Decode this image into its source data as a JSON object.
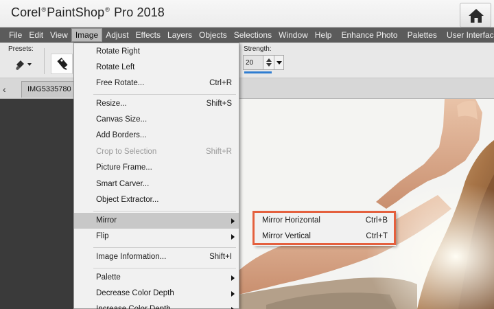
{
  "app": {
    "title_part1": "Corel",
    "title_reg": "®",
    "title_part2": "PaintShop",
    "title_reg2": "®",
    "title_part3": "Pro 2018"
  },
  "menubar": {
    "items": [
      "File",
      "Edit",
      "View",
      "Image",
      "Adjust",
      "Effects",
      "Layers",
      "Objects",
      "Selections",
      "Window",
      "Help",
      "Enhance Photo",
      "Palettes",
      "User Interface"
    ],
    "active": "Image"
  },
  "toolbar": {
    "presets_label": "Presets:",
    "strength_label": "Strength:",
    "strength_value": "20"
  },
  "tabs": {
    "document": "IMG5335780"
  },
  "image_menu": {
    "items": [
      {
        "label": "Rotate Right",
        "shortcut": ""
      },
      {
        "label": "Rotate Left",
        "shortcut": ""
      },
      {
        "label": "Free Rotate...",
        "shortcut": "Ctrl+R"
      },
      {
        "label": "Resize...",
        "shortcut": "Shift+S"
      },
      {
        "label": "Canvas Size...",
        "shortcut": ""
      },
      {
        "label": "Add Borders...",
        "shortcut": ""
      },
      {
        "label": "Crop to Selection",
        "shortcut": "Shift+R"
      },
      {
        "label": "Picture Frame...",
        "shortcut": ""
      },
      {
        "label": "Smart Carver...",
        "shortcut": ""
      },
      {
        "label": "Object Extractor...",
        "shortcut": ""
      },
      {
        "label": "Mirror",
        "shortcut": ""
      },
      {
        "label": "Flip",
        "shortcut": ""
      },
      {
        "label": "Image Information...",
        "shortcut": "Shift+I"
      },
      {
        "label": "Palette",
        "shortcut": ""
      },
      {
        "label": "Decrease Color Depth",
        "shortcut": ""
      },
      {
        "label": "Increase Color Depth",
        "shortcut": ""
      }
    ],
    "disabled": [
      "Crop to Selection"
    ],
    "highlighted": "Mirror"
  },
  "mirror_submenu": {
    "items": [
      {
        "label": "Mirror Horizontal",
        "shortcut": "Ctrl+B"
      },
      {
        "label": "Mirror Vertical",
        "shortcut": "Ctrl+T"
      }
    ],
    "highlight_color": "#e4603e"
  },
  "colors": {
    "menubar_bg": "#5b5b5b",
    "workspace_bg": "#3a3a3a",
    "accent": "#2f7dd1"
  }
}
